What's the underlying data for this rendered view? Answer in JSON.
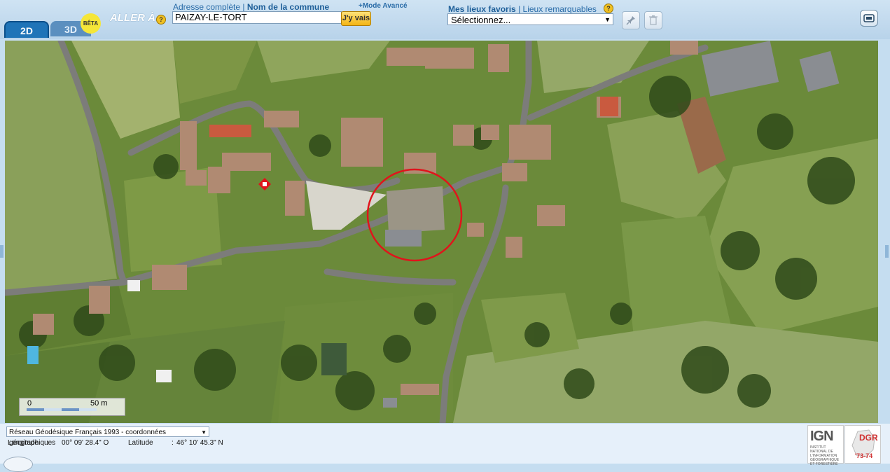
{
  "tabs": {
    "tab_2d": "2D",
    "tab_3d": "3D",
    "beta": "BÊTA"
  },
  "goto": {
    "label": "ALLER À",
    "help": "?"
  },
  "address": {
    "full_label": "Adresse complète",
    "separator": "|",
    "commune_label": "Nom de la commune",
    "value": "PAIZAY-LE-TORT",
    "go_button": "J'y vais",
    "advanced_link": "+Mode Avancé"
  },
  "favorites": {
    "label": "Mes lieux favoris",
    "separator": "|",
    "remarkable_label": "Lieux remarquables",
    "help": "?",
    "selected": "Sélectionnez..."
  },
  "scale": {
    "min_label": "0",
    "max_label": "50 m"
  },
  "projection": {
    "selected": "Réseau Géodésique Français 1993 - coordonnées géographiques"
  },
  "coordinates": {
    "longitude_label": "Longitude",
    "longitude_sep": ":",
    "longitude_value": "00° 09' 28.4\" O",
    "latitude_label": "Latitude",
    "latitude_sep": ":",
    "latitude_value": "46° 10' 45.3\" N"
  },
  "logos": {
    "ign": "IGN",
    "ign_sub": "INSTITUT NATIONAL DE L'INFORMATION GÉOGRAPHIQUE ET FORESTIÈRE",
    "dgr": "DGR",
    "dgr_years": "'73-74"
  },
  "colors": {
    "accent": "#1f74b8",
    "marker": "#e0141c"
  },
  "icons": [
    "pin-icon",
    "trash-icon",
    "screen-icon",
    "help-icon",
    "location-marker-icon"
  ]
}
